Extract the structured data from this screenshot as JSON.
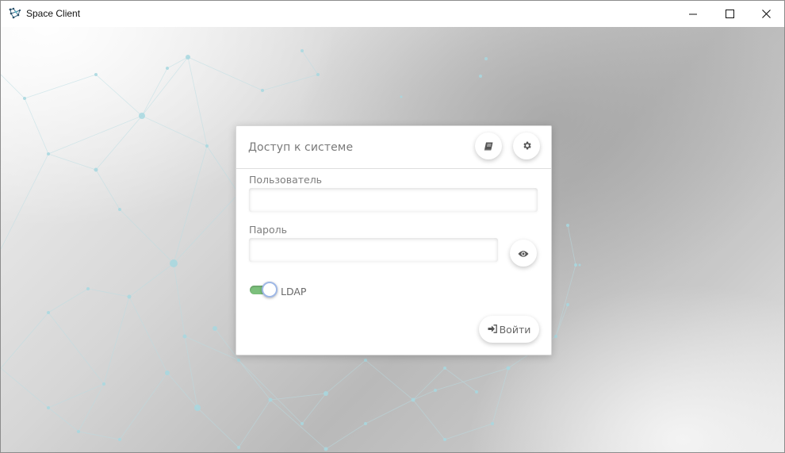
{
  "window": {
    "title": "Space Client",
    "icon": "space-client-app-icon"
  },
  "window_controls": {
    "minimize": "minimize-icon",
    "maximize": "maximize-icon",
    "close": "close-icon"
  },
  "login_dialog": {
    "title": "Доступ к системе",
    "help_icon": "book-icon",
    "settings_icon": "gear-icon",
    "username": {
      "label": "Пользователь",
      "value": ""
    },
    "password": {
      "label": "Пароль",
      "value": "",
      "show_icon": "eye-icon"
    },
    "ldap": {
      "label": "LDAP",
      "enabled": true
    },
    "login_button": {
      "label": "Войти",
      "icon": "sign-in-icon"
    }
  },
  "colors": {
    "toggle_on": "#7cc07c",
    "toggle_knob_ring": "#9fb8e6",
    "network_nodes": "#a8d8e0"
  }
}
